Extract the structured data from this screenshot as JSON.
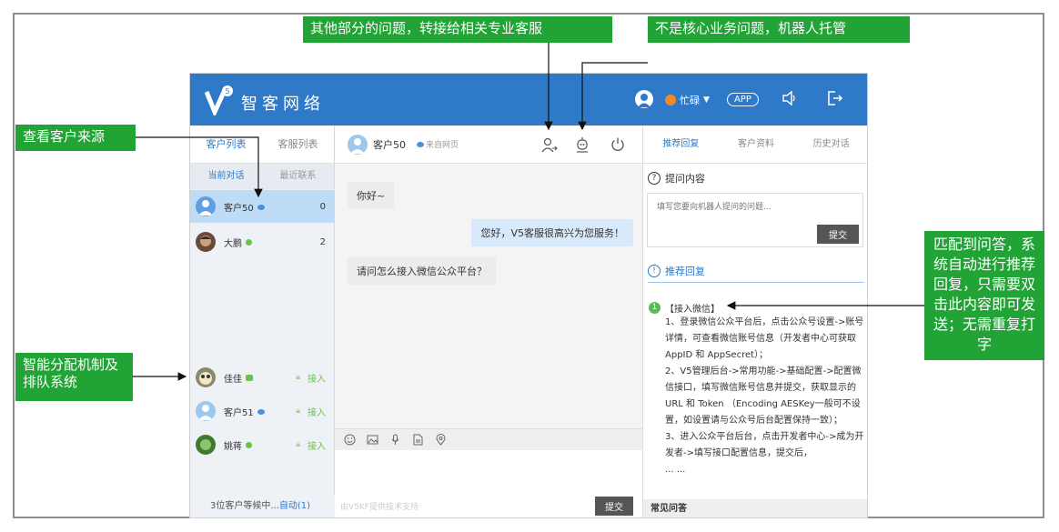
{
  "header": {
    "brand": "智客网络",
    "logo_badge": "5",
    "status_label": "忙碌",
    "app_label": "APP",
    "sound_icon": "sound-icon",
    "exit_icon": "exit-icon"
  },
  "left_panel": {
    "tabs": [
      "客户列表",
      "客服列表"
    ],
    "subtabs": [
      "当前对话",
      "最近联系"
    ],
    "active_chats": [
      {
        "name": "客户50",
        "count": "0",
        "source_icon": "weibo-icon"
      },
      {
        "name": "大鹏",
        "count": "2",
        "source_icon": "online-dot"
      }
    ],
    "queue": [
      {
        "name": "佳佳",
        "action": "接入",
        "source_icon": "wechat-icon"
      },
      {
        "name": "客户51",
        "action": "接入",
        "source_icon": "weibo-icon"
      },
      {
        "name": "姚蒋",
        "action": "接入",
        "source_icon": "online-dot"
      }
    ],
    "wait_text": "3位客户等候中...",
    "auto_text": "自动(1)"
  },
  "chat": {
    "customer_name": "客户50",
    "source_text": "来自网页",
    "messages": [
      {
        "from": "customer",
        "text": "你好~"
      },
      {
        "from": "agent",
        "text": "您好，V5客服很高兴为您服务！"
      },
      {
        "from": "customer",
        "text": "请问怎么接入微信公众平台？"
      }
    ],
    "powered_text": "由V5KF提供技术支持",
    "send_label": "提交"
  },
  "right_panel": {
    "tabs": [
      "推荐回复",
      "客户资料",
      "历史对话"
    ],
    "ask_title": "提问内容",
    "ask_placeholder": "填写您要向机器人提问的问题...",
    "ask_submit": "提交",
    "recommend_title": "推荐回复",
    "answer_title": "【接入微信】",
    "answer_lines": [
      "1、登录微信公众平台后，点击公众号设置->账号详情，可查看微信账号信息（开发者中心可获取 AppID 和 AppSecret）；",
      "2、V5管理后台->常用功能->基础配置->配置微信接口，填写微信账号信息并提交，获取显示的 URL 和 Token （Encoding AESKey一般可不设置，如设置请与公众号后台配置保持一致）；",
      "3、进入公众平台后台，点击开发者中心->成为开发者->填写接口配置信息，提交后，",
      "... ..."
    ],
    "faq_label": "常见问答"
  },
  "callouts": {
    "transfer": "其他部分的问题，转接给相关专业客服",
    "robot": "不是核心业务问题，机器人托管",
    "source": "查看客户来源",
    "dispatch": "智能分配机制及排队系统",
    "match": "匹配到问答，系统自动进行推荐回复，只需要双击此内容即可发送；无需重复打字"
  },
  "colors": {
    "brand_blue": "#2f79c9",
    "callout_green": "#21a336",
    "online_green": "#6cc24a",
    "busy_orange": "#f08a24"
  }
}
